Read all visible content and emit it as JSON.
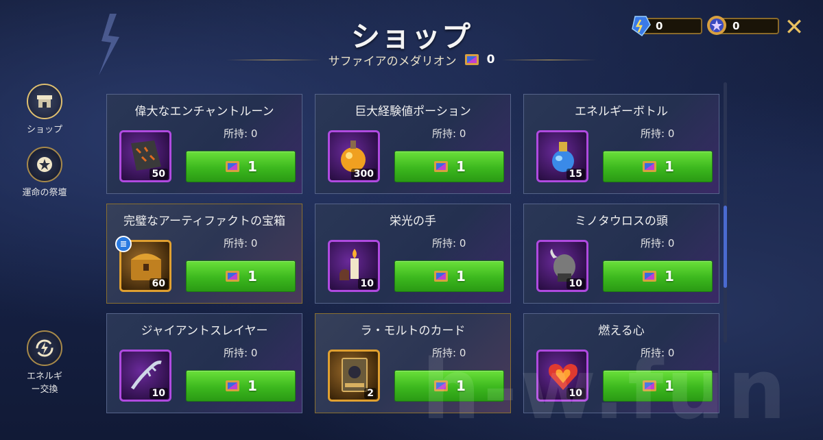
{
  "header": {
    "title": "ショップ",
    "subtitle": "サファイアのメダリオン",
    "subtitle_count": "0",
    "close_label": "✕"
  },
  "currencies": [
    {
      "name": "energy-crystal",
      "value": "0"
    },
    {
      "name": "medal",
      "value": "0"
    }
  ],
  "nav": [
    {
      "label": "ショップ",
      "icon": "shop-icon",
      "active": true
    },
    {
      "label": "運命の祭壇",
      "icon": "star-icon",
      "active": false
    },
    {
      "label": "エネルギー交換",
      "icon": "energy-exchange-icon",
      "active": false
    }
  ],
  "items": [
    {
      "title": "偉大なエンチャントルーン",
      "owned": "所持: 0",
      "qty": "50",
      "price": "1",
      "icon": "rune-icon",
      "frame": "purple"
    },
    {
      "title": "巨大経験値ポーション",
      "owned": "所持: 0",
      "qty": "300",
      "price": "1",
      "icon": "potion-icon",
      "frame": "purple"
    },
    {
      "title": "エネルギーボトル",
      "owned": "所持: 0",
      "qty": "15",
      "price": "1",
      "icon": "bottle-icon",
      "frame": "purple"
    },
    {
      "title": "完璧なアーティファクトの宝箱",
      "owned": "所持: 0",
      "qty": "60",
      "price": "1",
      "icon": "chest-icon",
      "frame": "gold"
    },
    {
      "title": "栄光の手",
      "owned": "所持: 0",
      "qty": "10",
      "price": "1",
      "icon": "candle-icon",
      "frame": "purple"
    },
    {
      "title": "ミノタウロスの頭",
      "owned": "所持: 0",
      "qty": "10",
      "price": "1",
      "icon": "minotaur-head-icon",
      "frame": "purple"
    },
    {
      "title": "ジャイアントスレイヤー",
      "owned": "所持: 0",
      "qty": "10",
      "price": "1",
      "icon": "horn-icon",
      "frame": "purple"
    },
    {
      "title": "ラ・モルトのカード",
      "owned": "所持: 0",
      "qty": "2",
      "price": "1",
      "icon": "card-icon",
      "frame": "gold"
    },
    {
      "title": "燃える心",
      "owned": "所持: 0",
      "qty": "10",
      "price": "1",
      "icon": "burning-heart-icon",
      "frame": "purple"
    }
  ],
  "watermark": "h-w.fun"
}
